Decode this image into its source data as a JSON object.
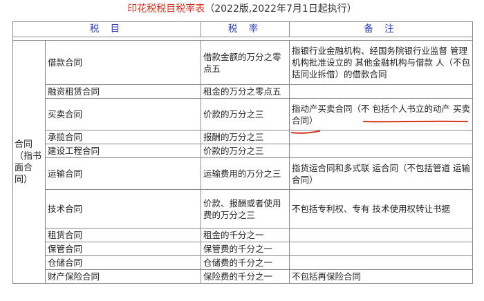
{
  "title": {
    "main": "印花税税目税率表",
    "edition": "（2022版,2022年7月1日起执行）"
  },
  "table": {
    "headers": {
      "item": "税 目",
      "rate": "税 率",
      "note": "备 注"
    },
    "category": "合同（指书面合同）",
    "rows": [
      {
        "item": "借款合同",
        "rate": "借款金额的万分之零点五",
        "note": "指银行业金融机构、经国务院银行业监督 管理机构批准设立的 其他金融机构与借款 人（不包括同业拆借）的借款合同"
      },
      {
        "item": "融资租赁合同",
        "rate": "租金的万分之零点五",
        "note": ""
      },
      {
        "item": "买卖合同",
        "rate": "价款的万分之三",
        "note": "指动产买卖合同（不 包括个人书立的动产 买卖合同）"
      },
      {
        "item": "承揽合同",
        "rate": "报酬的万分之三",
        "note": ""
      },
      {
        "item": "建设工程合同",
        "rate": "价款的万分之三",
        "note": ""
      },
      {
        "item": "运输合同",
        "rate": "运输费用的万分之三",
        "note": "指货运合同和多式联 运合同（不包括管道 运输合同）"
      },
      {
        "item": "技术合同",
        "rate": "价款、报酬或者使用费的万分之三",
        "note": "不包括专利权、专有 技术使用权转让书据"
      },
      {
        "item": "租赁合同",
        "rate": "租金的千分之一",
        "note": ""
      },
      {
        "item": "保管合同",
        "rate": "保管费的千分之一",
        "note": ""
      },
      {
        "item": "仓储合同",
        "rate": "仓储费的千分之一",
        "note": ""
      },
      {
        "item": "财产保险合同",
        "rate": "保险费的千分之一",
        "note": "不包括再保险合同"
      }
    ]
  },
  "colors": {
    "title_red": "#d8321e",
    "header_blue": "#2f3fbd",
    "mark_red": "#d8321e"
  }
}
